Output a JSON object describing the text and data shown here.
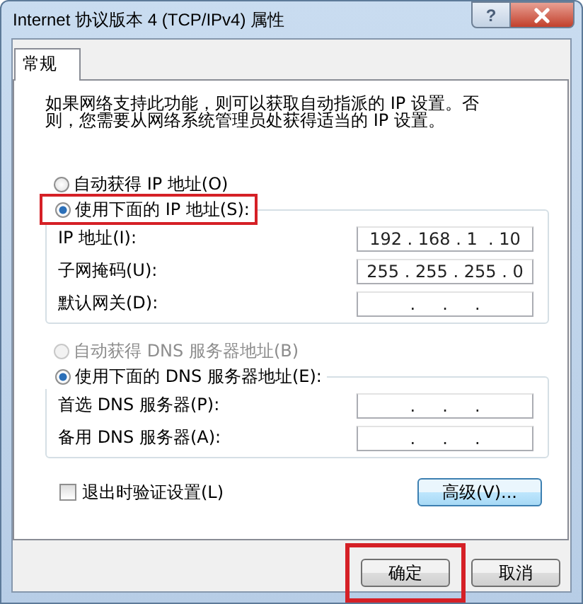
{
  "window": {
    "title": "Internet 协议版本 4 (TCP/IPv4) 属性",
    "help": "?"
  },
  "tabs": [
    {
      "label": "常规",
      "selected": true
    }
  ],
  "description": "如果网络支持此功能，则可以获取自动指派的 IP 设置。否则，您需要从网络系统管理员处获得适当的 IP 设置。",
  "sections": [
    {
      "options": [
        {
          "label": "自动获得 IP 地址(O)",
          "selected": false,
          "disabled": false,
          "highlighted": false
        },
        {
          "label": "使用下面的 IP 地址(S):",
          "selected": true,
          "disabled": false,
          "highlighted": true
        }
      ],
      "fields": [
        {
          "label": "IP 地址(I):",
          "value": "192 . 168 . 1  . 10"
        },
        {
          "label": "子网掩码(U):",
          "value": "255 . 255 . 255 . 0"
        },
        {
          "label": "默认网关(D):",
          "value": ".     .     ."
        }
      ]
    },
    {
      "options": [
        {
          "label": "自动获得 DNS 服务器地址(B)",
          "selected": false,
          "disabled": true,
          "highlighted": false
        },
        {
          "label": "使用下面的 DNS 服务器地址(E):",
          "selected": true,
          "disabled": false,
          "highlighted": false
        }
      ],
      "fields": [
        {
          "label": "首选 DNS 服务器(P):",
          "value": ".     .     ."
        },
        {
          "label": "备用 DNS 服务器(A):",
          "value": ".     .     ."
        }
      ]
    }
  ],
  "validate_on_exit": {
    "label": "退出时验证设置(L)",
    "checked": false
  },
  "advanced_button": "高级(V)...",
  "buttons": [
    {
      "label": "确定",
      "highlighted": true
    },
    {
      "label": "取消",
      "highlighted": false
    }
  ]
}
